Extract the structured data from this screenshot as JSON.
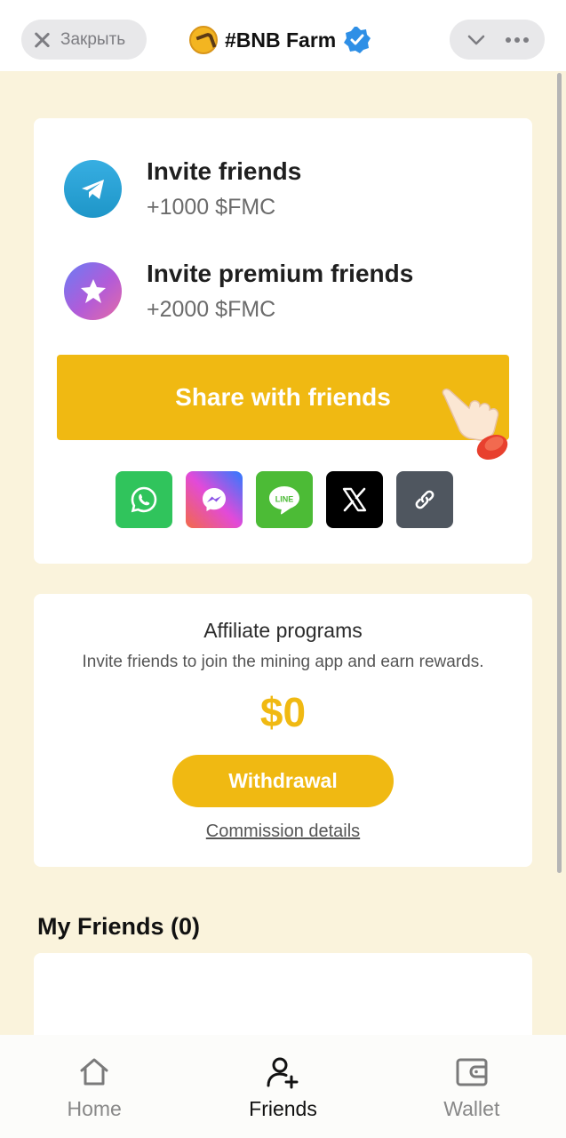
{
  "header": {
    "close_label": "Закрыть",
    "app_title": "#BNB Farm"
  },
  "invites": [
    {
      "title": "Invite friends",
      "reward": "+1000 $FMC",
      "icon": "telegram-icon"
    },
    {
      "title": "Invite premium friends",
      "reward": "+2000 $FMC",
      "icon": "premium-star-icon"
    }
  ],
  "share": {
    "button_label": "Share with friends",
    "social": [
      "whatsapp-icon",
      "messenger-icon",
      "line-icon",
      "x-icon",
      "link-icon"
    ],
    "line_text": "LINE"
  },
  "affiliate": {
    "title": "Affiliate programs",
    "description": "Invite friends to join the mining app and earn rewards.",
    "amount": "$0",
    "withdraw_label": "Withdrawal",
    "commission_label": "Commission details"
  },
  "friends": {
    "heading": "My Friends (0)"
  },
  "nav": {
    "items": [
      {
        "label": "Home",
        "icon": "home-icon"
      },
      {
        "label": "Friends",
        "icon": "add-friend-icon"
      },
      {
        "label": "Wallet",
        "icon": "wallet-icon"
      }
    ],
    "active": "Friends"
  },
  "colors": {
    "accent": "#f0b912",
    "background": "#faf3dc"
  }
}
